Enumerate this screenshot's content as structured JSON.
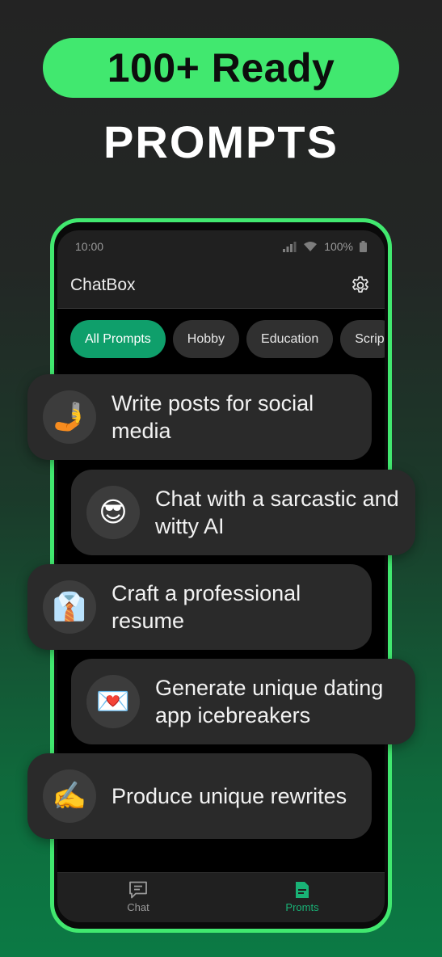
{
  "promo": {
    "headline": "100+ Ready",
    "subheadline": "PROMPTS"
  },
  "status_bar": {
    "time": "10:00",
    "battery": "100%"
  },
  "app": {
    "title": "ChatBox"
  },
  "categories": {
    "items": [
      "All Prompts",
      "Hobby",
      "Education",
      "Scrip"
    ],
    "selected": "All Prompts"
  },
  "prompts": [
    {
      "icon": "🤳",
      "icon_name": "selfie-icon",
      "text": "Write posts for social media"
    },
    {
      "icon": "😎",
      "icon_name": "sunglasses-face-icon",
      "text": "Chat with a sarcastic and witty AI"
    },
    {
      "icon": "👔",
      "icon_name": "necktie-icon",
      "text": "Craft a professional resume"
    },
    {
      "icon": "💌",
      "icon_name": "love-letter-icon",
      "text": "Generate unique dating app icebreakers"
    },
    {
      "icon": "✍️",
      "icon_name": "writing-hand-icon",
      "text": "Produce unique rewrites"
    }
  ],
  "bottom_nav": {
    "chat_label": "Chat",
    "prompts_label": "Promts",
    "active": "Promts"
  },
  "colors": {
    "accent": "#41e86f",
    "chip_active": "#0f9f6b",
    "nav_active": "#19b276"
  }
}
